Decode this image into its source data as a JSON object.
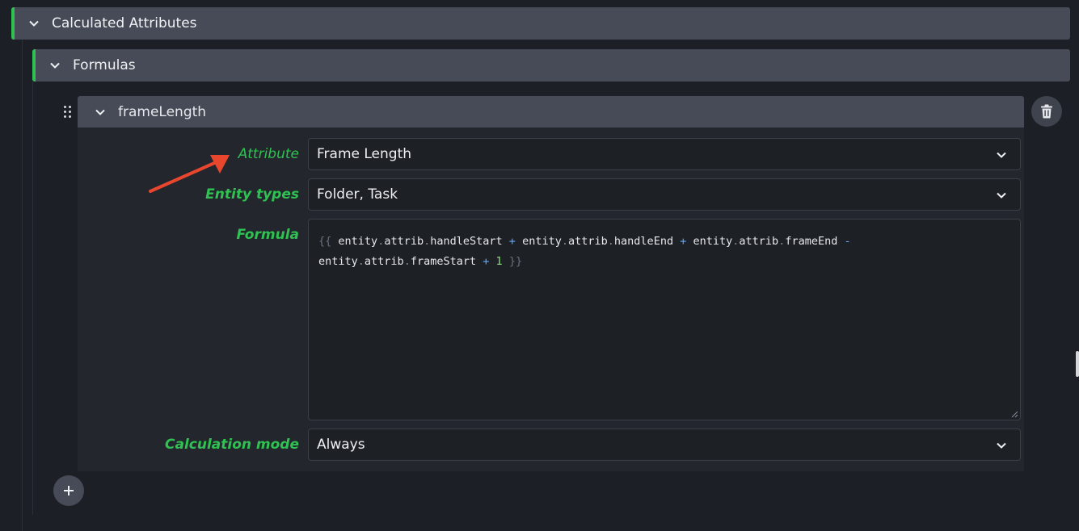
{
  "sections": {
    "calculated_attributes": "Calculated Attributes",
    "formulas": "Formulas"
  },
  "item": {
    "title": "frameLength",
    "fields": {
      "attribute": {
        "label": "Attribute",
        "value": "Frame Length"
      },
      "entity_types": {
        "label": "Entity types",
        "value": "Folder, Task"
      },
      "formula": {
        "label": "Formula",
        "line1": [
          "{{",
          "entity",
          ".",
          "attrib",
          ".",
          "handleStart",
          "+",
          "entity",
          ".",
          "attrib",
          ".",
          "handleEnd",
          "+",
          "entity",
          ".",
          "attrib",
          ".",
          "frameEnd",
          "-"
        ],
        "line2": [
          "entity",
          ".",
          "attrib",
          ".",
          "frameStart",
          "+",
          "1",
          "}}"
        ]
      },
      "calculation_mode": {
        "label": "Calculation mode",
        "value": "Always"
      }
    }
  },
  "icons": {
    "section_toggle": "chevron-down-icon",
    "drag": "drag-handle-icon",
    "delete": "trash-icon",
    "add": "plus-icon",
    "annotation": "red-arrow-icon"
  },
  "colors": {
    "accent_green": "#2fc252",
    "header_bg": "#464b57",
    "annotation_red": "#e8472e"
  }
}
